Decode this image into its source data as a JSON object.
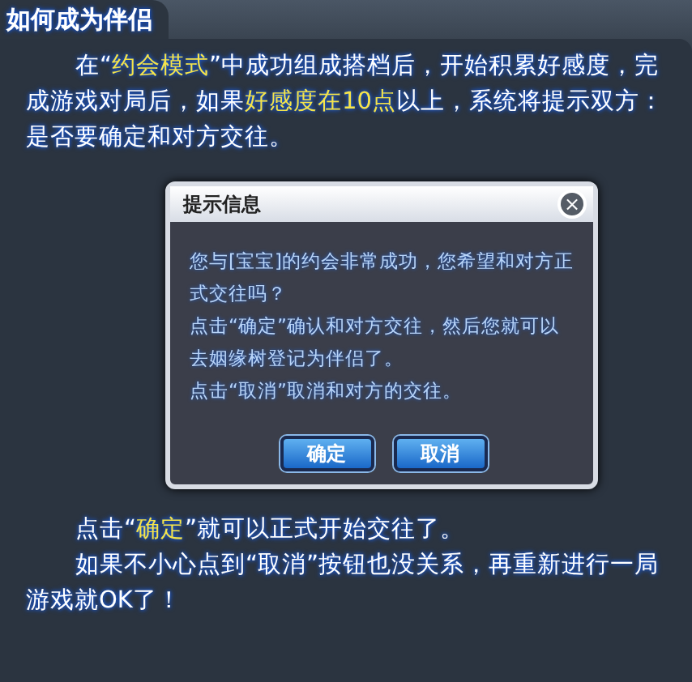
{
  "tab": {
    "title": "如何成为伴侣"
  },
  "intro": "在“**约会模式**”中成功组成搭档后，开始积累好感度，完成游戏对局后，如果**好感度在10点**以上，系统将提示双方：是否要确定和对方交往。",
  "dialog": {
    "title": "提示信息",
    "close": "×",
    "lines": [
      "您与[宝宝]的约会非常成功，您希望和对方正式交往吗？",
      "点击“确定”确认和对方交往，然后您就可以去姻缘树登记为伴侣了。",
      "点击“取消”取消和对方的交往。"
    ],
    "buttons": [
      {
        "label": "确定"
      },
      {
        "label": "取消"
      }
    ]
  },
  "outro": [
    "点击“**确定**”就可以正式开始交往了。",
    "如果不小心点到“取消”按钮也没关系，再重新进行一局游戏就OK了！"
  ]
}
